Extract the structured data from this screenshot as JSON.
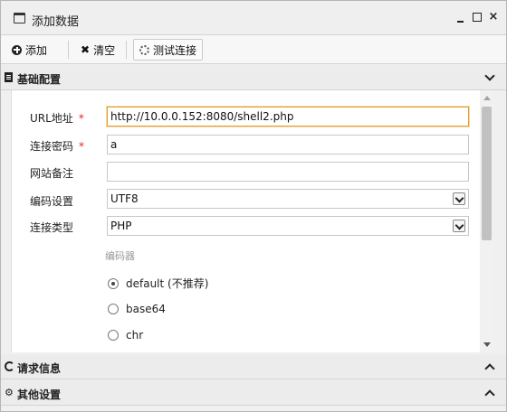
{
  "window": {
    "title": "添加数据",
    "controls": {
      "minimize": "minimize",
      "maximize": "maximize",
      "close": "×"
    }
  },
  "toolbar": {
    "add_label": "添加",
    "clear_label": "清空",
    "test_label": "测试连接"
  },
  "sections": {
    "basic": {
      "title": "基础配置",
      "expanded": true
    },
    "request": {
      "title": "请求信息",
      "expanded": false
    },
    "other": {
      "title": "其他设置",
      "expanded": false
    }
  },
  "form": {
    "url": {
      "label": "URL地址",
      "required_mark": "*",
      "value": "http://10.0.0.152:8080/shell2.php"
    },
    "password": {
      "label": "连接密码",
      "required_mark": "*",
      "value": "a"
    },
    "note": {
      "label": "网站备注",
      "value": ""
    },
    "encoding": {
      "label": "编码设置",
      "value": "UTF8"
    },
    "type": {
      "label": "连接类型",
      "value": "PHP"
    },
    "encoder": {
      "heading": "编码器",
      "options": [
        {
          "label": "default (不推荐)",
          "checked": true
        },
        {
          "label": "base64",
          "checked": false
        },
        {
          "label": "chr",
          "checked": false
        }
      ]
    }
  }
}
